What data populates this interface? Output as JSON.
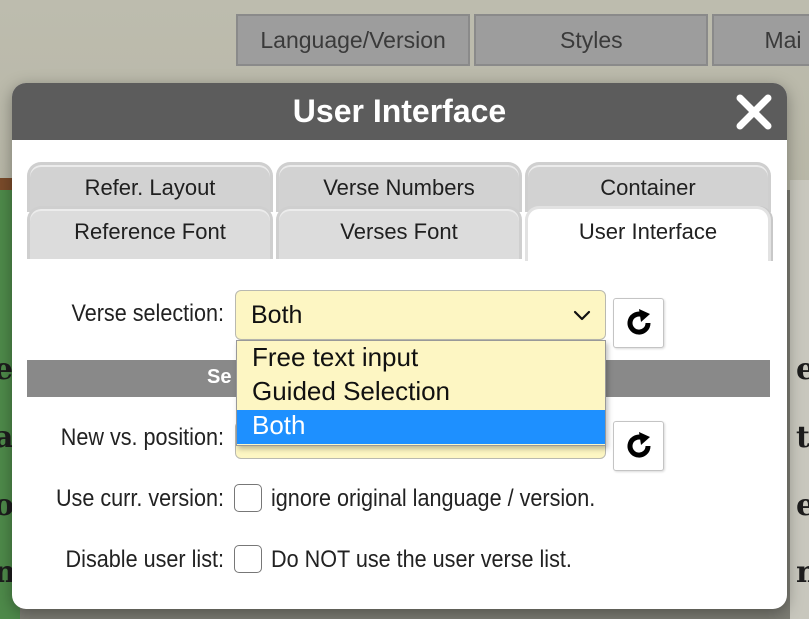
{
  "background": {
    "toolbar_tabs": [
      "Language/Version",
      "Styles",
      "Mai"
    ]
  },
  "dialog": {
    "title": "User Interface",
    "close_icon": "close-icon",
    "tabs_back": [
      "Refer. Layout",
      "Verse Numbers",
      "Container"
    ],
    "tabs_front": [
      "Reference Font",
      "Verses Font",
      "User Interface"
    ],
    "active_tab": "User Interface"
  },
  "form": {
    "verse_selection_label": "Verse selection:",
    "verse_selection_value": "Both",
    "verse_selection_options": [
      "Free text input",
      "Guided Selection",
      "Both"
    ],
    "section_text": "Se",
    "new_vs_position_label": "New vs. position:",
    "use_curr_version_label": "Use curr. version:",
    "use_curr_version_text": "ignore original language / version.",
    "disable_user_list_label": "Disable user list:",
    "disable_user_list_text": "Do NOT use the user verse list.",
    "reset_icon": "refresh-icon"
  },
  "colors": {
    "header": "#5c5c5c",
    "select_bg": "#fdf6c3",
    "selected_option": "#1e90ff"
  }
}
